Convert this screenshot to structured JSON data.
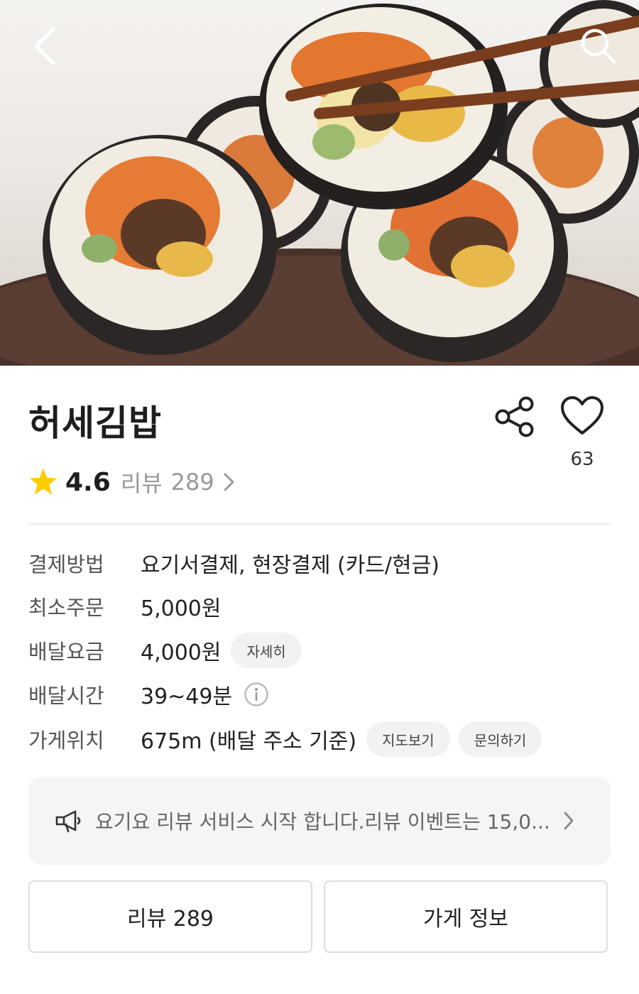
{
  "store": {
    "name": "허세김밥",
    "rating": "4.6",
    "review_label": "리뷰",
    "review_count": "289",
    "like_count": "63"
  },
  "info": [
    {
      "label": "결제방법",
      "value": "요기서결제, 현장결제 (카드/현금)"
    },
    {
      "label": "최소주문",
      "value": "5,000원"
    },
    {
      "label": "배달요금",
      "value": "4,000원",
      "button": "자세히"
    },
    {
      "label": "배달시간",
      "value": "39~49분"
    },
    {
      "label": "가게위치",
      "value": "675m (배달 주소 기준)",
      "buttons": [
        "지도보기",
        "문의하기"
      ]
    }
  ],
  "notice": {
    "text": "요기요 리뷰 서비스 시작 합니다.리뷰 이벤트는 15,0..."
  },
  "tabs": {
    "reviews": "리뷰 289",
    "store_info": "가게 정보"
  },
  "icons": {
    "back": "chevron-left-icon",
    "search": "search-icon",
    "share": "share-icon",
    "like": "heart-icon",
    "star": "star-icon",
    "info": "info-icon",
    "notice": "megaphone-icon"
  },
  "colors": {
    "star": "#FFCC00",
    "text": "#222222",
    "muted": "#999999",
    "pill_bg": "#F2F2F2",
    "notice_bg": "#F5F5F5"
  }
}
